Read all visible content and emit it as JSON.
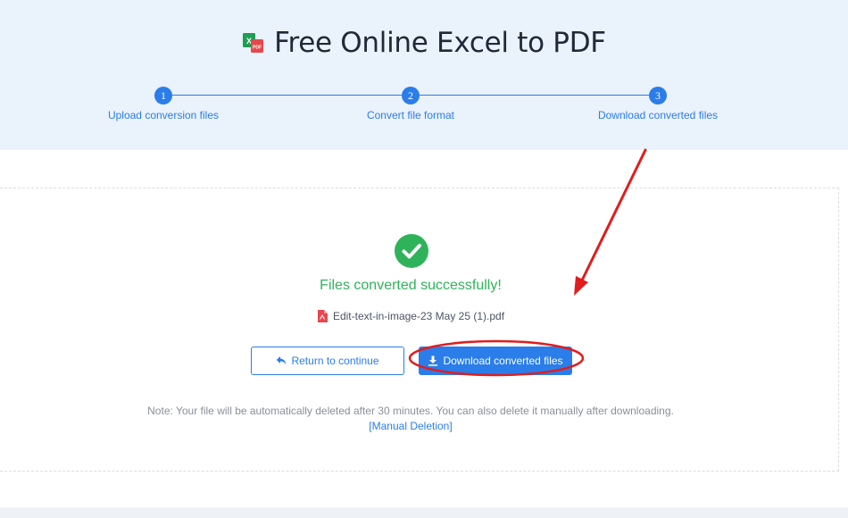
{
  "header": {
    "title": "Free Online Excel to PDF",
    "logo_icon": "excel-to-pdf-icon"
  },
  "steps": [
    {
      "number": "1",
      "label": "Upload conversion files"
    },
    {
      "number": "2",
      "label": "Convert file format"
    },
    {
      "number": "3",
      "label": "Download converted files"
    }
  ],
  "result": {
    "success_message": "Files converted successfully!",
    "file_name": "Edit-text-in-image-23 May 25 (1).pdf",
    "return_label": "Return to continue",
    "download_label": "Download converted files",
    "note": "Note: Your file will be automatically deleted after 30 minutes. You can also delete it manually after downloading.",
    "manual_deletion_label": "[Manual Deletion]"
  },
  "colors": {
    "accent": "#2b7de9",
    "success": "#2fb35a",
    "header_bg": "#eaf2fb",
    "annotation_red": "#e11d1d"
  }
}
